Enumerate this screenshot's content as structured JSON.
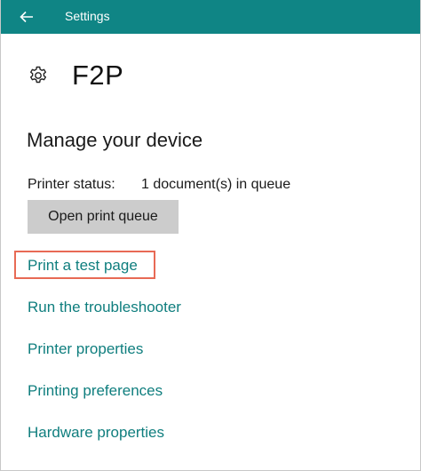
{
  "window": {
    "title": "Settings",
    "accent_color": "#0f8585"
  },
  "icons": {
    "back": "back-arrow-icon",
    "settings": "gear-icon"
  },
  "header": {
    "device_name": "F2P"
  },
  "manage": {
    "section_title": "Manage your device",
    "status_label": "Printer status:",
    "status_value": "1 document(s) in queue",
    "open_queue_label": "Open print queue"
  },
  "links": {
    "print_test_page": "Print a test page",
    "troubleshooter": "Run the troubleshooter",
    "printer_properties": "Printer properties",
    "printing_preferences": "Printing preferences",
    "hardware_properties": "Hardware properties"
  },
  "colors": {
    "link": "#0f7e7e",
    "highlight": "#e86a55",
    "button_bg": "#cccccc"
  }
}
